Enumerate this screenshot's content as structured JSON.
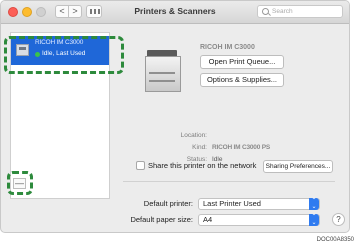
{
  "window": {
    "title": "Printers & Scanners",
    "search_placeholder": "Search",
    "back_glyph": "<",
    "forward_glyph": ">"
  },
  "printer_list": {
    "selected": {
      "name": "RICOH IM C3000",
      "status": "Idle, Last Used"
    },
    "remove_glyph": "—"
  },
  "details": {
    "printer_name": "RICOH IM C3000",
    "open_queue_label": "Open Print Queue...",
    "options_supplies_label": "Options & Supplies...",
    "location_label": "Location:",
    "location_value": "",
    "kind_label": "Kind:",
    "kind_value": "RICOH IM C3000 PS",
    "status_label": "Status:",
    "status_value": "Idle",
    "share_label": "Share this printer on the network",
    "share_checked": false,
    "sharing_prefs_label": "Sharing Preferences..."
  },
  "footer": {
    "default_printer_label": "Default printer:",
    "default_printer_value": "Last Printer Used",
    "default_paper_label": "Default paper size:",
    "default_paper_value": "A4",
    "help_glyph": "?"
  },
  "caption": "DOC00A8350",
  "colors": {
    "selection": "#1f67d8",
    "highlight_dash": "#2d8a3c",
    "status_dot": "#39c24a",
    "popup_accent": "#2f7bf0"
  }
}
